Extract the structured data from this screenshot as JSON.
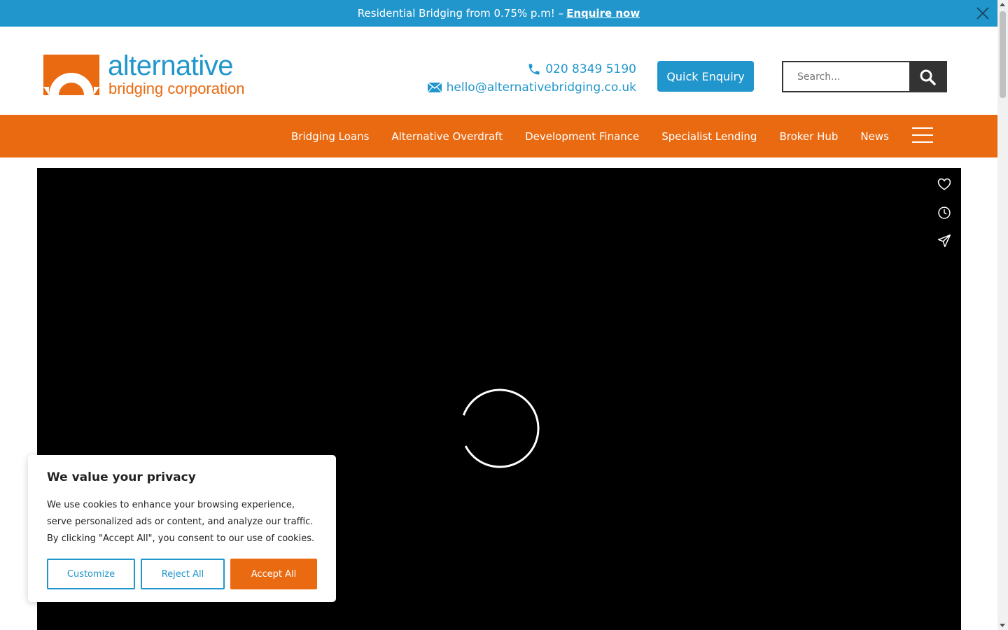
{
  "colors": {
    "brand_blue": "#2196cc",
    "brand_orange": "#ea6a12",
    "dark": "#333333"
  },
  "topbar": {
    "text": "Residential Bridging from 0.75% p.m! –",
    "link": "Enquire now"
  },
  "logo": {
    "line1": "alternative",
    "line2": "bridging corporation"
  },
  "contact": {
    "phone": "020 8349 5190",
    "email": "hello@alternativebridging.co.uk"
  },
  "quick_enquiry_label": "Quick Enquiry",
  "search": {
    "placeholder": "Search..."
  },
  "nav": {
    "items": [
      {
        "label": "Bridging Loans"
      },
      {
        "label": "Alternative Overdraft"
      },
      {
        "label": "Development Finance"
      },
      {
        "label": "Specialist Lending"
      },
      {
        "label": "Broker Hub"
      },
      {
        "label": "News"
      }
    ]
  },
  "video": {
    "icons": [
      "heart-icon",
      "clock-icon",
      "send-icon"
    ]
  },
  "cookie": {
    "title": "We value your privacy",
    "text": "We use cookies to enhance your browsing experience, serve personalized ads or content, and analyze our traffic. By clicking \"Accept All\", you consent to our use of cookies.",
    "customize": "Customize",
    "reject": "Reject All",
    "accept": "Accept All"
  }
}
